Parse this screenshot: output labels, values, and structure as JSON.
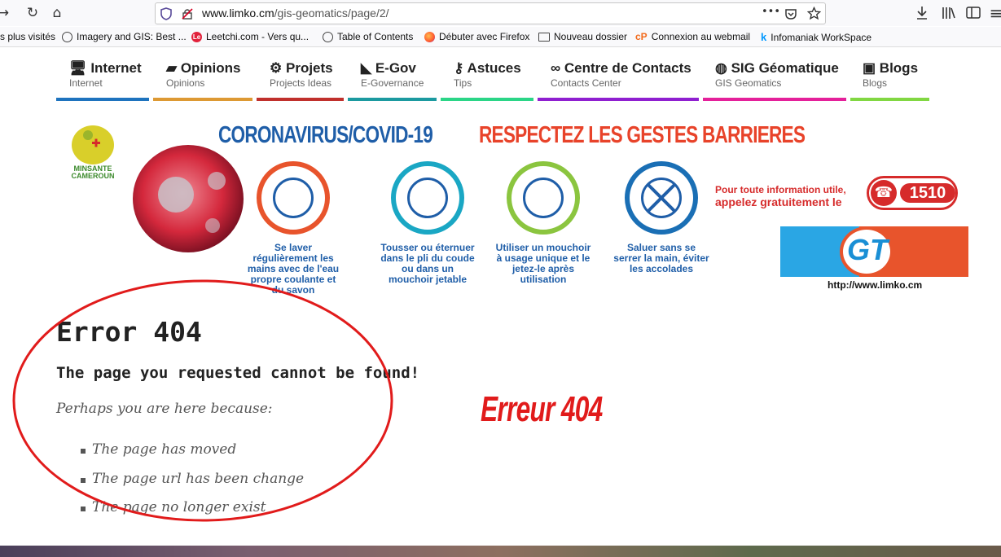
{
  "browser": {
    "url_host": "www.limko.cm",
    "url_path": "/gis-geomatics/page/2/",
    "menu_glyph": "•••",
    "bookmarks": [
      {
        "label": "s plus visités",
        "icon": ""
      },
      {
        "label": "Imagery and GIS: Best ...",
        "icon": "globe-icon"
      },
      {
        "label": "Leetchi.com - Vers qu...",
        "icon": "leetchi-icon"
      },
      {
        "label": "Table of Contents",
        "icon": "globe-icon"
      },
      {
        "label": "Débuter avec Firefox",
        "icon": "firefox-icon"
      },
      {
        "label": "Nouveau dossier",
        "icon": "folder-icon"
      },
      {
        "label": "Connexion au webmail",
        "icon": "webmail-icon"
      },
      {
        "label": "Infomaniak WorkSpace",
        "icon": "infomaniak-icon"
      }
    ]
  },
  "nav": [
    {
      "label": "Internet",
      "sub": "Internet",
      "icon": "monitor-icon",
      "color": "#1e73be"
    },
    {
      "label": "Opinions",
      "sub": "Opinions",
      "icon": "comment-icon",
      "color": "#dd9933"
    },
    {
      "label": "Projets",
      "sub": "Projects Ideas",
      "icon": "gear-icon",
      "color": "#c0302c"
    },
    {
      "label": "E-Gov",
      "sub": "E-Governance",
      "icon": "rss-icon",
      "color": "#1b9aa0"
    },
    {
      "label": "Astuces",
      "sub": "Tips",
      "icon": "key-icon",
      "color": "#2bd587"
    },
    {
      "label": "Centre de Contacts",
      "sub": "Contacts Center",
      "icon": "link-icon",
      "color": "#8f1fd0"
    },
    {
      "label": "SIG Géomatique",
      "sub": "GIS Geomatics",
      "icon": "globe-icon",
      "color": "#e4209a"
    },
    {
      "label": "Blogs",
      "sub": "Blogs",
      "icon": "blog-icon",
      "color": "#81d742"
    }
  ],
  "banner": {
    "logo_line1": "MINSANTE",
    "logo_line2": "CAMEROUN",
    "title_left": "CORONAVIRUS/COVID-19",
    "title_right": "RESPECTEZ LES GESTES BARRIERES",
    "tips": [
      {
        "caption": "Se laver régulièrement les mains avec de l'eau propre coulante et du savon",
        "color": "#e8542c"
      },
      {
        "caption": "Tousser ou éternuer dans le pli du coude ou dans un mouchoir jetable",
        "color": "#1aa7c4"
      },
      {
        "caption": "Utiliser un mouchoir à usage unique et le jetez-le après utilisation",
        "color": "#8bc53f"
      },
      {
        "caption": "Saluer sans se serrer la main, éviter les accolades",
        "color": "#1a6fb5"
      }
    ],
    "info_line1": "Pour toute information utile,",
    "info_line2": "appelez gratuitement le",
    "hotline": "1510",
    "gt_logo": "GT",
    "gt_url": "http://www.limko.cm"
  },
  "content": {
    "title": "Error 404",
    "subtitle": "The page you requested cannot be found!",
    "intro": "Perhaps you are here because:",
    "reasons": [
      "The page has moved",
      "The page url has been change",
      "The page no longer exist"
    ],
    "annotation": "Erreur 404"
  },
  "colors": {
    "accent_red": "#e11b1b",
    "banner_blue": "#1f5ea8",
    "banner_red": "#e8432a"
  }
}
